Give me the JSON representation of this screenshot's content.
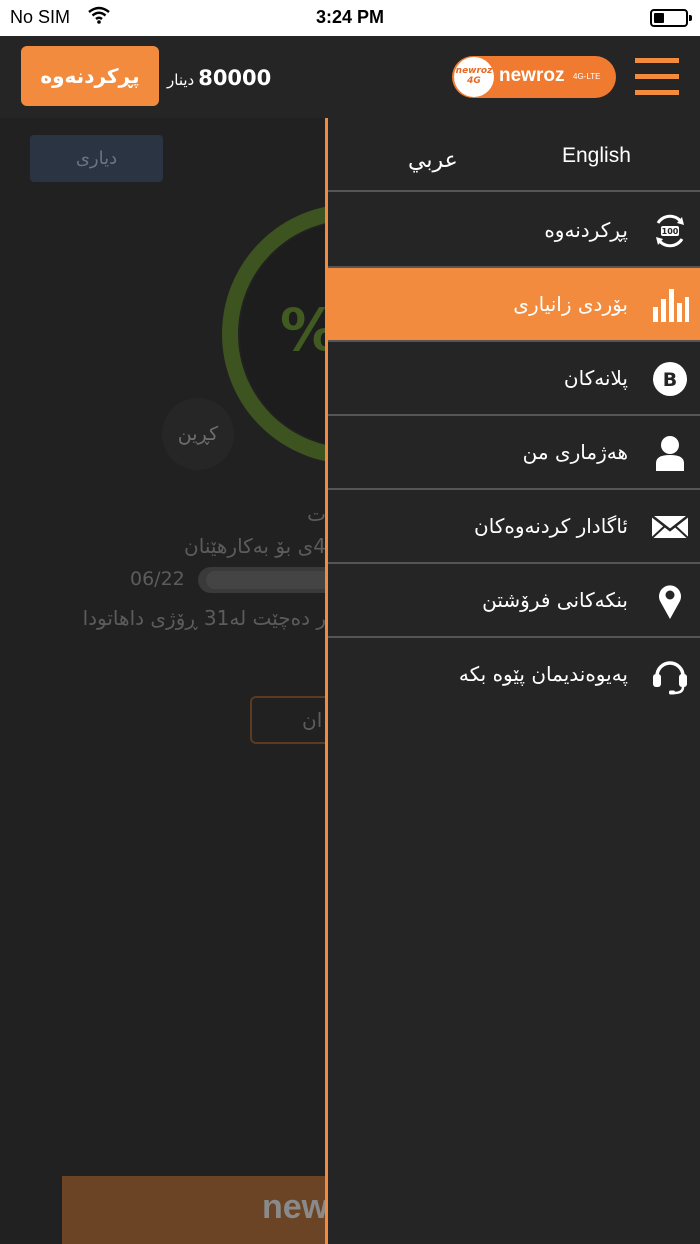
{
  "status_bar": {
    "carrier": "No SIM",
    "time": "3:24 PM"
  },
  "header": {
    "recharge_label": "پڕکردنەوە",
    "balance_value": "80000",
    "balance_unit": "دینار",
    "logo_word": "newroz",
    "logo_tag": "4G-LTE",
    "logo_badge_top": "newroz",
    "logo_badge_bottom": "4G"
  },
  "main": {
    "gift_label": "دیاری",
    "percent_symbol": "%",
    "buy_label": "کڕین",
    "line1": "ت",
    "line2": "4ی بۆ بەکارهێنان",
    "date": "06/22",
    "line3": "ر دەچێت لە31 ڕۆژی داهاتودا",
    "button_label": "ان",
    "footer_word": "new"
  },
  "drawer": {
    "languages": {
      "arabic": "عربي",
      "english": "English"
    },
    "items": [
      {
        "label": "پڕکردنەوە",
        "icon": "recharge-100-icon",
        "active": false
      },
      {
        "label": "بۆردی زانیاری",
        "icon": "bar-chart-icon",
        "active": true
      },
      {
        "label": "پلانەکان",
        "icon": "b-circle-icon",
        "active": false
      },
      {
        "label": "هەژماری من",
        "icon": "user-icon",
        "active": false
      },
      {
        "label": "ئاگادار کردنەوەکان",
        "icon": "envelope-icon",
        "active": false
      },
      {
        "label": "بنکەکانی فرۆشتن",
        "icon": "location-pin-icon",
        "active": false
      },
      {
        "label": "پەیوەندیمان پێوە بکە",
        "icon": "headset-icon",
        "active": false
      }
    ]
  },
  "colors": {
    "accent": "#f28b3d",
    "background": "#252525",
    "divider": "#555555"
  }
}
